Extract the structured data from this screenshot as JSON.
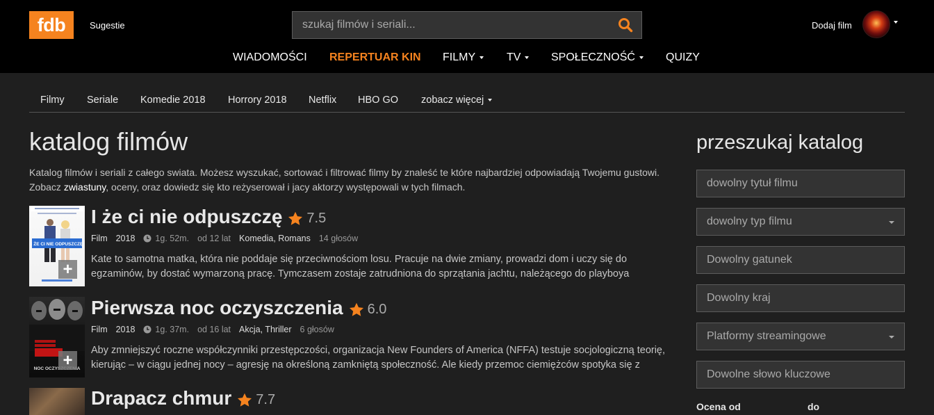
{
  "header": {
    "logo": "fdb",
    "sugestie": "Sugestie",
    "search_placeholder": "szukaj filmów i seriali...",
    "add_film": "Dodaj film",
    "nav": [
      {
        "label": "WIADOMOŚCI",
        "dropdown": false
      },
      {
        "label": "REPERTUAR KIN",
        "dropdown": false,
        "active": true
      },
      {
        "label": "FILMY",
        "dropdown": true
      },
      {
        "label": "TV",
        "dropdown": true
      },
      {
        "label": "SPOŁECZNOŚĆ",
        "dropdown": true
      },
      {
        "label": "QUIZY",
        "dropdown": false
      }
    ]
  },
  "subnav": [
    {
      "label": "Filmy"
    },
    {
      "label": "Seriale"
    },
    {
      "label": "Komedie 2018"
    },
    {
      "label": "Horrory 2018"
    },
    {
      "label": "Netflix"
    },
    {
      "label": "HBO GO"
    },
    {
      "label": "zobacz więcej",
      "dropdown": true
    }
  ],
  "main": {
    "title": "katalog filmów",
    "intro_before": "Katalog filmów i seriali z całego swiata. Możesz wyszukać, sortować i filtrować filmy by znaleść te które najbardziej odpowiadają Twojemu gustowi. Zobacz ",
    "intro_link": "zwiastuny",
    "intro_after": ", oceny, oraz dowiedz się kto reżyserował i jacy aktorzy występowali w tych filmach.",
    "movies": [
      {
        "title": "I że ci nie odpuszczę",
        "rating": "7.5",
        "type": "Film",
        "year": "2018",
        "duration": "1g. 52m.",
        "age": "od 12 lat",
        "genres": "Komedia, Romans",
        "votes": "14 głosów",
        "description": "Kate to samotna matka, która nie poddaje się przeciwnościom losu. Pracuje na dwie zmiany, prowadzi dom i uczy się do egzaminów, by dostać wymarzoną pracę. Tymczasem zostaje zatrudniona do sprzątania jachtu, należącego do playboya",
        "poster_text": "I ŻE CI NIE ODPUSZCZĘ"
      },
      {
        "title": "Pierwsza noc oczyszczenia",
        "rating": "6.0",
        "type": "Film",
        "year": "2018",
        "duration": "1g. 37m.",
        "age": "od 16 lat",
        "genres": "Akcja, Thriller",
        "votes": "6 głosów",
        "description": "Aby zmniejszyć roczne współczynniki przestępczości, organizacja New Founders of America (NFFA) testuje socjologiczną teorię, kierując – w ciągu jednej nocy – agresję na określoną zamkniętą społeczność. Ale kiedy przemoc ciemiężców spotyka się z",
        "poster_text": "NOC OCZYSZCZENIA"
      },
      {
        "title": "Drapacz chmur",
        "rating": "7.7"
      }
    ]
  },
  "sidebar": {
    "title": "przeszukaj katalog",
    "fields": [
      {
        "label": "dowolny tytuł filmu",
        "select": false
      },
      {
        "label": "dowolny typ filmu",
        "select": true
      },
      {
        "label": "Dowolny gatunek",
        "select": false
      },
      {
        "label": "Dowolny kraj",
        "select": false
      },
      {
        "label": "Platformy streamingowe",
        "select": true
      },
      {
        "label": "Dowolne słowo kluczowe",
        "select": false
      }
    ],
    "ocena_od": "Ocena od",
    "ocena_do": "do"
  },
  "colors": {
    "accent": "#f5831f",
    "header_bg": "#000000",
    "page_bg": "#1f1f1f",
    "field_bg": "#333333"
  }
}
